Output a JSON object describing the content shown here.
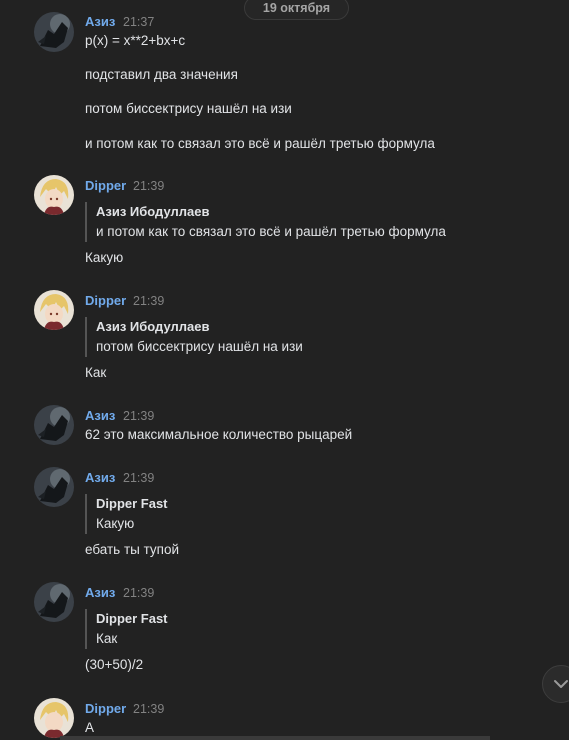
{
  "date_divider": "19 октября",
  "messages": [
    {
      "author": "Азиз",
      "time": "21:37",
      "avatar": "aziz",
      "lines": [
        "p(x) = x**2+bx+c",
        "подставил два значения",
        "потом биссектрису нашёл на изи",
        "и потом как то связал это всё и рашёл третью формула"
      ]
    },
    {
      "author": "Dipper",
      "time": "21:39",
      "avatar": "dipper",
      "quote_author": "Азиз Ибодуллаев",
      "quote_text": "и потом как то связал это всё и рашёл третью формула",
      "text": "Какую"
    },
    {
      "author": "Dipper",
      "time": "21:39",
      "avatar": "dipper",
      "quote_author": "Азиз Ибодуллаев",
      "quote_text": "потом биссектрису нашёл на изи",
      "text": "Как"
    },
    {
      "author": "Азиз",
      "time": "21:39",
      "avatar": "aziz",
      "text": "62 это максимальное количество рыцарей"
    },
    {
      "author": "Азиз",
      "time": "21:39",
      "avatar": "aziz",
      "quote_author": "Dipper Fast",
      "quote_text": "Какую",
      "text": "ебать ты тупой"
    },
    {
      "author": "Азиз",
      "time": "21:39",
      "avatar": "aziz",
      "quote_author": "Dipper Fast",
      "quote_text": "Как",
      "text": "(30+50)/2"
    },
    {
      "author": "Dipper",
      "time": "21:39",
      "avatar": "dipper",
      "text": "А"
    }
  ],
  "icons": {
    "scroll_down": "chevron-down-icon",
    "aziz_avatar": "dark-raven-avatar",
    "dipper_avatar": "anime-blonde-avatar"
  },
  "colors": {
    "background": "#222222",
    "author": "#71aaeb",
    "text": "#e1e3e6",
    "meta": "#828282"
  }
}
